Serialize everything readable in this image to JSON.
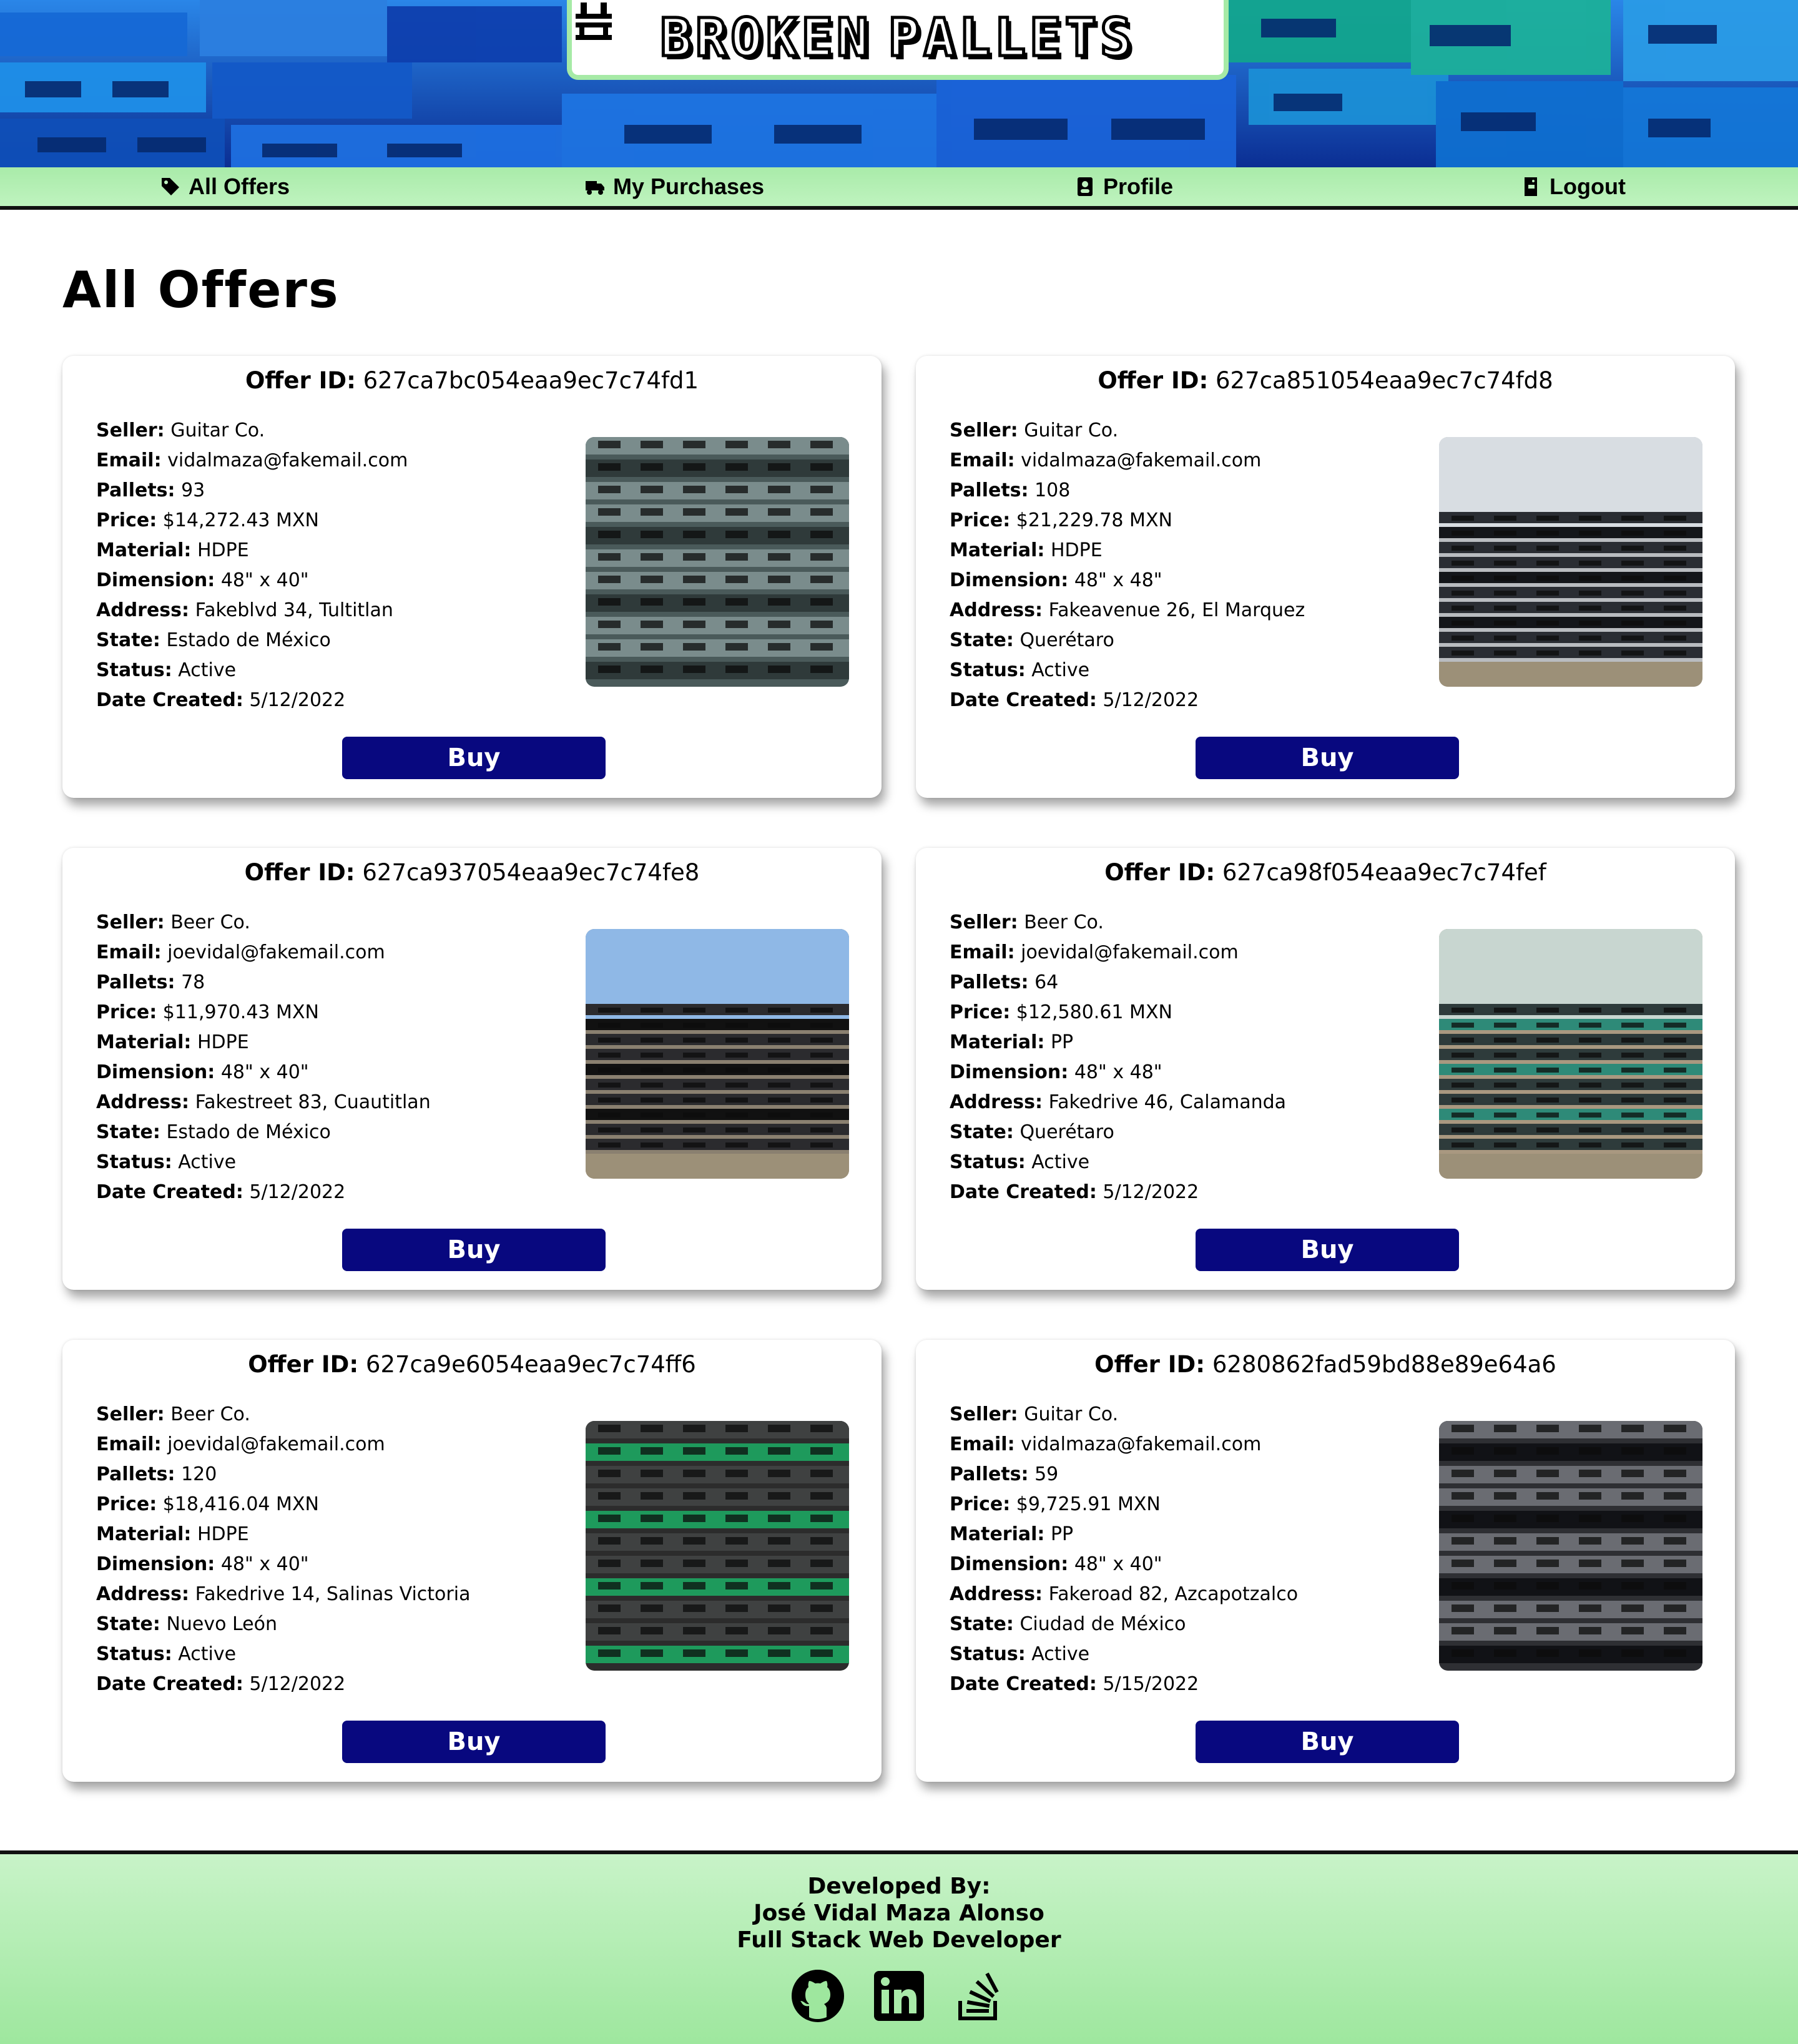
{
  "app": {
    "logo_text_left": "BROKEN",
    "logo_text_right": "PALLETS",
    "logo_icon": "pallet-icon"
  },
  "nav": {
    "items": [
      {
        "label": "All Offers",
        "icon": "tag-icon"
      },
      {
        "label": "My Purchases",
        "icon": "truck-icon"
      },
      {
        "label": "Profile",
        "icon": "id-badge-icon"
      },
      {
        "label": "Logout",
        "icon": "door-exit-icon"
      }
    ]
  },
  "page": {
    "title": "All Offers"
  },
  "labels": {
    "offer_id": "Offer ID:",
    "seller": "Seller:",
    "email": "Email:",
    "pallets": "Pallets:",
    "price": "Price:",
    "material": "Material:",
    "dimension": "Dimension:",
    "address": "Address:",
    "state": "State:",
    "status": "Status:",
    "date_created": "Date Created:",
    "buy": "Buy"
  },
  "offers": [
    {
      "id": "627ca7bc054eaa9ec7c74fd1",
      "seller": "Guitar Co.",
      "email": "vidalmaza@fakemail.com",
      "pallets": "93",
      "price": "$14,272.43 MXN",
      "material": "HDPE",
      "dimension": "48\" x 40\"",
      "address": "Fakeblvd 34, Tultitlan",
      "state": "Estado de México",
      "status": "Active",
      "date_created": "5/12/2022"
    },
    {
      "id": "627ca851054eaa9ec7c74fd8",
      "seller": "Guitar Co.",
      "email": "vidalmaza@fakemail.com",
      "pallets": "108",
      "price": "$21,229.78 MXN",
      "material": "HDPE",
      "dimension": "48\" x 48\"",
      "address": "Fakeavenue 26, El Marquez",
      "state": "Querétaro",
      "status": "Active",
      "date_created": "5/12/2022"
    },
    {
      "id": "627ca937054eaa9ec7c74fe8",
      "seller": "Beer Co.",
      "email": "joevidal@fakemail.com",
      "pallets": "78",
      "price": "$11,970.43 MXN",
      "material": "HDPE",
      "dimension": "48\" x 40\"",
      "address": "Fakestreet 83, Cuautitlan",
      "state": "Estado de México",
      "status": "Active",
      "date_created": "5/12/2022"
    },
    {
      "id": "627ca98f054eaa9ec7c74fef",
      "seller": "Beer Co.",
      "email": "joevidal@fakemail.com",
      "pallets": "64",
      "price": "$12,580.61 MXN",
      "material": "PP",
      "dimension": "48\" x 48\"",
      "address": "Fakedrive 46, Calamanda",
      "state": "Querétaro",
      "status": "Active",
      "date_created": "5/12/2022"
    },
    {
      "id": "627ca9e6054eaa9ec7c74ff6",
      "seller": "Beer Co.",
      "email": "joevidal@fakemail.com",
      "pallets": "120",
      "price": "$18,416.04 MXN",
      "material": "HDPE",
      "dimension": "48\" x 40\"",
      "address": "Fakedrive 14, Salinas Victoria",
      "state": "Nuevo León",
      "status": "Active",
      "date_created": "5/12/2022"
    },
    {
      "id": "6280862fad59bd88e89e64a6",
      "seller": "Guitar Co.",
      "email": "vidalmaza@fakemail.com",
      "pallets": "59",
      "price": "$9,725.91 MXN",
      "material": "PP",
      "dimension": "48\" x 40\"",
      "address": "Fakeroad 82, Azcapotzalco",
      "state": "Ciudad de México",
      "status": "Active",
      "date_created": "5/15/2022"
    }
  ],
  "footer": {
    "line1": "Developed By:",
    "line2": "José Vidal Maza Alonso",
    "line3": "Full Stack Web Developer",
    "icons": [
      "github-icon",
      "linkedin-icon",
      "stackoverflow-icon"
    ]
  },
  "colors": {
    "accent_green": "#a9eba9",
    "buy_button": "#08087f",
    "banner_blue": "#1a4fc4"
  }
}
